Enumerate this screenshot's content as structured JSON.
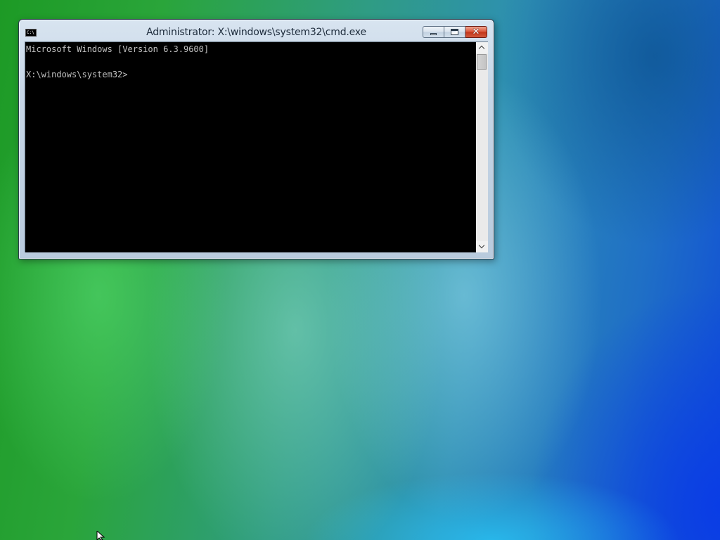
{
  "window": {
    "title": "Administrator: X:\\windows\\system32\\cmd.exe",
    "icon": "cmd-icon",
    "icon_text": "C:\\",
    "controls": {
      "minimize": "minimize-icon",
      "maximize": "maximize-icon",
      "close": "close-icon",
      "close_glyph": "✕"
    }
  },
  "console": {
    "lines": [
      "Microsoft Windows [Version 6.3.9600]",
      "",
      "X:\\windows\\system32>"
    ],
    "foreground": "#c0c0c0",
    "background": "#000000"
  },
  "colors": {
    "close_button": "#c7391c",
    "titlebar": "#c6d6e6"
  }
}
